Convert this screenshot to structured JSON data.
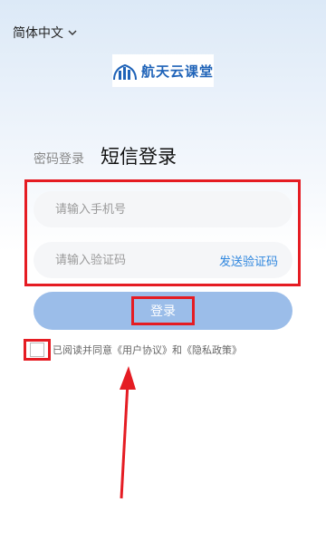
{
  "header": {
    "language": "简体中文",
    "language_icon": "chevron-down-icon"
  },
  "logo": {
    "text": "航天云课堂",
    "icon": "city-buildings-icon"
  },
  "tabs": {
    "password_login": "密码登录",
    "sms_login": "短信登录"
  },
  "form": {
    "phone_placeholder": "请输入手机号",
    "code_placeholder": "请输入验证码",
    "send_code": "发送验证码",
    "login": "登录"
  },
  "agreement": {
    "prefix": "已阅读并同意",
    "user_agreement": "《用户协议》",
    "and": "和",
    "privacy_policy": "《隐私政策》"
  },
  "colors": {
    "accent": "#2e86de",
    "login_button": "#9bbde9",
    "highlight": "#e51c23",
    "brand": "#1f63b8"
  }
}
